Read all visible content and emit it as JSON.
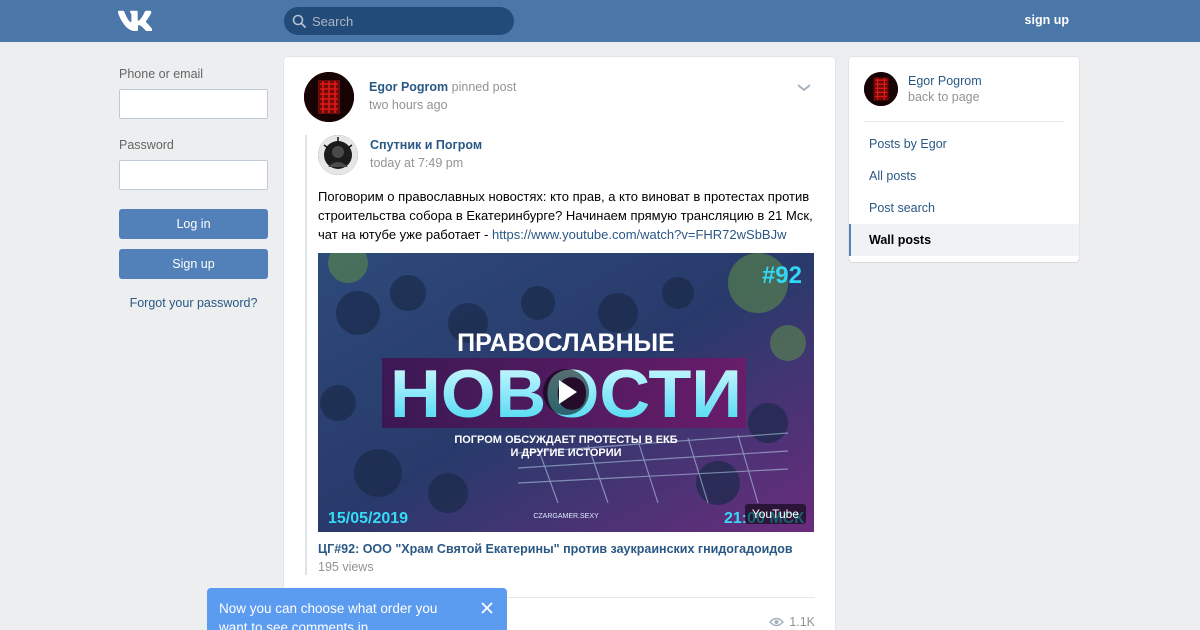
{
  "header": {
    "search_placeholder": "Search",
    "signup_link": "sign up",
    "brand_color": "#4a76a8"
  },
  "login": {
    "phone_label": "Phone or email",
    "password_label": "Password",
    "login_button": "Log in",
    "signup_button": "Sign up",
    "forgot_link": "Forgot your password?"
  },
  "post": {
    "author": "Egor Pogrom",
    "pinned_label": "pinned post",
    "time": "two hours ago",
    "repost": {
      "author": "Спутник и Погром",
      "time": "today at 7:49 pm",
      "text": "Поговорим о православных новостях: кто прав, а кто виноват в протестах против строительства собора в Екатеринбурге? Начинаем прямую трансляцию в 21 Мск, чат на ютубе уже работает - ",
      "link": "https://www.youtube.com/watch?v=FHR72wSbBJw"
    },
    "video": {
      "overlay_number": "#92",
      "overlay_line1": "ПРАВОСЛАВНЫЕ",
      "overlay_line2": "НОВОСТИ",
      "overlay_sub1": "ПОГРОМ ОБСУЖДАЕТ ПРОТЕСТЫ В ЕКБ",
      "overlay_sub2": "И ДРУГИЕ ИСТОРИИ",
      "overlay_date": "15/05/2019",
      "overlay_channel": "CZARGAMER.SEXY",
      "overlay_time": "21:00 МСК",
      "source_badge": "YouTube",
      "title": "ЦГ#92: ООО \"Храм Святой Екатерины\" против заукраинских гнидогадоидов",
      "views": "195 views"
    },
    "views_count": "1.1K"
  },
  "sidebar": {
    "name": "Egor Pogrom",
    "back": "back to page",
    "items": [
      {
        "label": "Posts by Egor"
      },
      {
        "label": "All posts"
      },
      {
        "label": "Post search"
      },
      {
        "label": "Wall posts"
      }
    ]
  },
  "toast": {
    "text": "Now you can choose what order you want to see comments in"
  }
}
